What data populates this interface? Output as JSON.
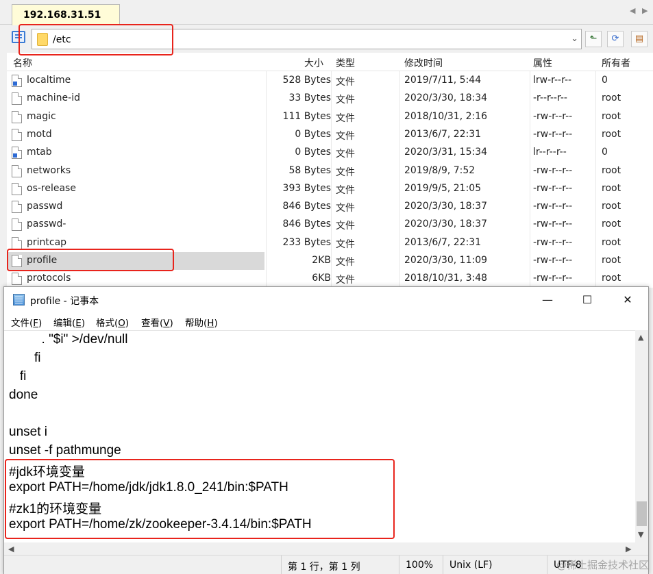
{
  "tab": {
    "title": "192.168.31.51",
    "close": "✕"
  },
  "tabnav": {
    "prev": "◀",
    "next": "▶"
  },
  "address": {
    "path": "/etc"
  },
  "columns": [
    "名称",
    "大小",
    "类型",
    "修改时间",
    "属性",
    "所有者"
  ],
  "files": [
    {
      "name": "localtime",
      "size": "528 Bytes",
      "type": "文件",
      "modified": "2019/7/11, 5:44",
      "attrs": "lrw-r--r--",
      "owner": "0",
      "link": true
    },
    {
      "name": "machine-id",
      "size": "33 Bytes",
      "type": "文件",
      "modified": "2020/3/30, 18:34",
      "attrs": "-r--r--r--",
      "owner": "root",
      "link": false
    },
    {
      "name": "magic",
      "size": "111 Bytes",
      "type": "文件",
      "modified": "2018/10/31, 2:16",
      "attrs": "-rw-r--r--",
      "owner": "root",
      "link": false
    },
    {
      "name": "motd",
      "size": "0 Bytes",
      "type": "文件",
      "modified": "2013/6/7, 22:31",
      "attrs": "-rw-r--r--",
      "owner": "root",
      "link": false
    },
    {
      "name": "mtab",
      "size": "0 Bytes",
      "type": "文件",
      "modified": "2020/3/31, 15:34",
      "attrs": "lr--r--r--",
      "owner": "0",
      "link": true
    },
    {
      "name": "networks",
      "size": "58 Bytes",
      "type": "文件",
      "modified": "2019/8/9, 7:52",
      "attrs": "-rw-r--r--",
      "owner": "root",
      "link": false
    },
    {
      "name": "os-release",
      "size": "393 Bytes",
      "type": "文件",
      "modified": "2019/9/5, 21:05",
      "attrs": "-rw-r--r--",
      "owner": "root",
      "link": false
    },
    {
      "name": "passwd",
      "size": "846 Bytes",
      "type": "文件",
      "modified": "2020/3/30, 18:37",
      "attrs": "-rw-r--r--",
      "owner": "root",
      "link": false
    },
    {
      "name": "passwd-",
      "size": "846 Bytes",
      "type": "文件",
      "modified": "2020/3/30, 18:37",
      "attrs": "-rw-r--r--",
      "owner": "root",
      "link": false
    },
    {
      "name": "printcap",
      "size": "233 Bytes",
      "type": "文件",
      "modified": "2013/6/7, 22:31",
      "attrs": "-rw-r--r--",
      "owner": "root",
      "link": false
    },
    {
      "name": "profile",
      "size": "2KB",
      "type": "文件",
      "modified": "2020/3/30, 11:09",
      "attrs": "-rw-r--r--",
      "owner": "root",
      "link": false,
      "selected": true
    },
    {
      "name": "protocols",
      "size": "6KB",
      "type": "文件",
      "modified": "2018/10/31, 3:48",
      "attrs": "-rw-r--r--",
      "owner": "root",
      "link": false
    }
  ],
  "notepad": {
    "title": "profile - 记事本",
    "window_buttons": {
      "minimize": "—",
      "maximize": "☐",
      "close": "✕"
    },
    "menu": [
      {
        "label": "文件(",
        "key": "F",
        "end": ")"
      },
      {
        "label": "编辑(",
        "key": "E",
        "end": ")"
      },
      {
        "label": "格式(",
        "key": "O",
        "end": ")"
      },
      {
        "label": "查看(",
        "key": "V",
        "end": ")"
      },
      {
        "label": "帮助(",
        "key": "H",
        "end": ")"
      }
    ],
    "lines": [
      "         . \"$i\" >/dev/null",
      "       fi",
      "   fi",
      "done",
      "",
      "unset i",
      "unset -f pathmunge",
      "#jdk环境变量",
      "export PATH=/home/jdk/jdk1.8.0_241/bin:$PATH",
      "#zk1的环境变量",
      "export PATH=/home/zk/zookeeper-3.4.14/bin:$PATH"
    ],
    "scroll_up": "▲",
    "scroll_down": "▼",
    "scroll_left": "◀",
    "scroll_right": "▶",
    "status": {
      "position": "第 1 行，第 1 列",
      "zoom": "100%",
      "line_ending": "Unix (LF)",
      "encoding": "UTF-8"
    }
  },
  "watermark": "@稀土掘金技术社区",
  "colors": {
    "highlight_box": "#e8241c",
    "tab_bg": "#fffcd8",
    "selected_row": "#d9d9d9"
  },
  "icons": [
    "folder-icon",
    "file-icon",
    "symlink-file-icon",
    "notepad-icon",
    "chevron-down-icon",
    "folder-up-icon",
    "refresh-icon",
    "view-icon"
  ]
}
